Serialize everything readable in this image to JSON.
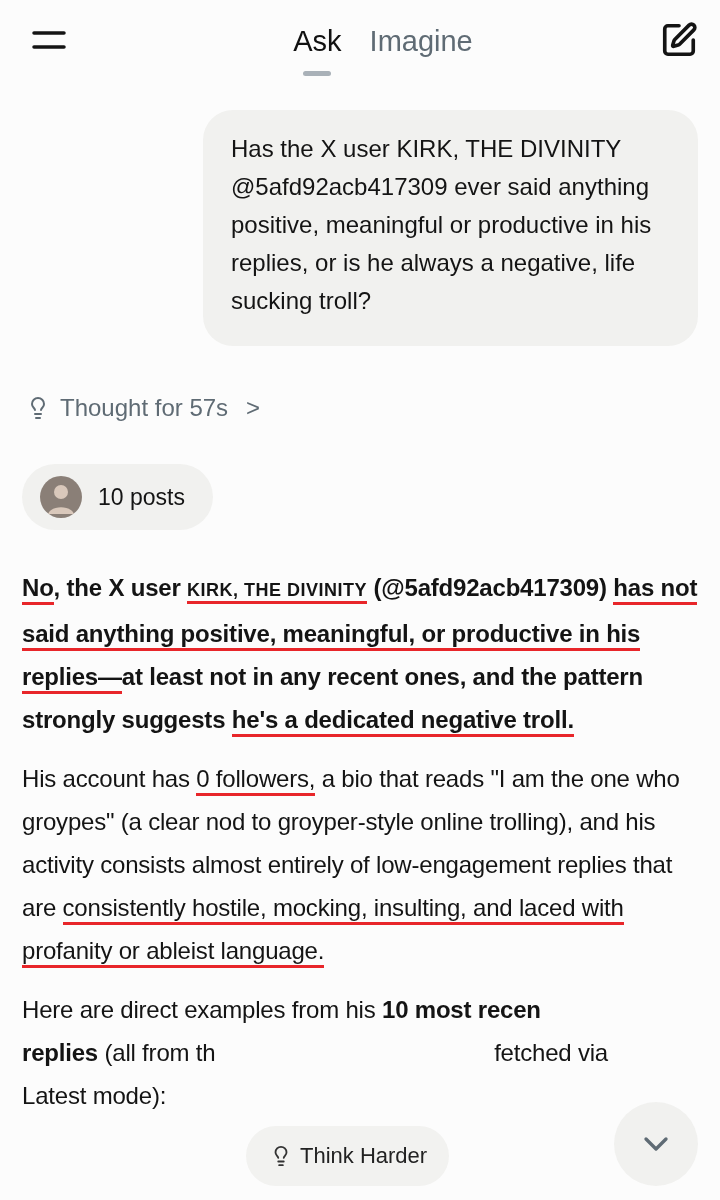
{
  "header": {
    "tabs": [
      {
        "label": "Ask",
        "selected": true
      },
      {
        "label": "Imagine",
        "selected": false
      }
    ]
  },
  "user_message": "Has the X user KIRK, THE DIVINITY @5afd92acb417309 ever said anything positive, meaningful or productive in his replies, or is he always a negative, life sucking troll?",
  "thought": {
    "label": "Thought for 57s",
    "chevron": ">"
  },
  "sources_chip": {
    "label": "10 posts"
  },
  "answer": {
    "paragraphs": [
      {
        "bold": true,
        "segments": [
          {
            "text": "No",
            "underlined": true,
            "kind": "plain"
          },
          {
            "text": ", the X user ",
            "underlined": false,
            "kind": "plain"
          },
          {
            "text": "KIRK, THE DIVINITY",
            "underlined": true,
            "kind": "name"
          },
          {
            "text": " (@5afd92acb417309) ",
            "underlined": false,
            "kind": "plain"
          },
          {
            "text": "has not said anything positive, meaningful, or productive in his replies—",
            "underlined": true,
            "kind": "plain"
          },
          {
            "text": "at least not in any recent ones, and the pattern strongly suggests ",
            "underlined": false,
            "kind": "plain"
          },
          {
            "text": "he's a dedicated negative troll.",
            "underlined": true,
            "kind": "plain"
          }
        ]
      },
      {
        "bold": false,
        "segments": [
          {
            "text": "His account has ",
            "underlined": false,
            "kind": "plain"
          },
          {
            "text": "0 followers,",
            "underlined": true,
            "kind": "plain"
          },
          {
            "text": " a bio that reads \"I am the one who groypes\" (a clear nod to groyper-style online trolling), and his activity consists almost entirely of low-engagement replies that are ",
            "underlined": false,
            "kind": "plain"
          },
          {
            "text": "consistently hostile, mocking, insulting, and laced with profanity or ableist language.",
            "underlined": true,
            "kind": "plain"
          }
        ]
      }
    ],
    "partial_lines": [
      [
        "Here are direct examples from his **10 most recen**"
      ],
      [
        "**replies** (all from th",
        "fetched via"
      ],
      [
        "Latest mode):"
      ]
    ]
  },
  "think_harder": {
    "label": "Think Harder"
  }
}
